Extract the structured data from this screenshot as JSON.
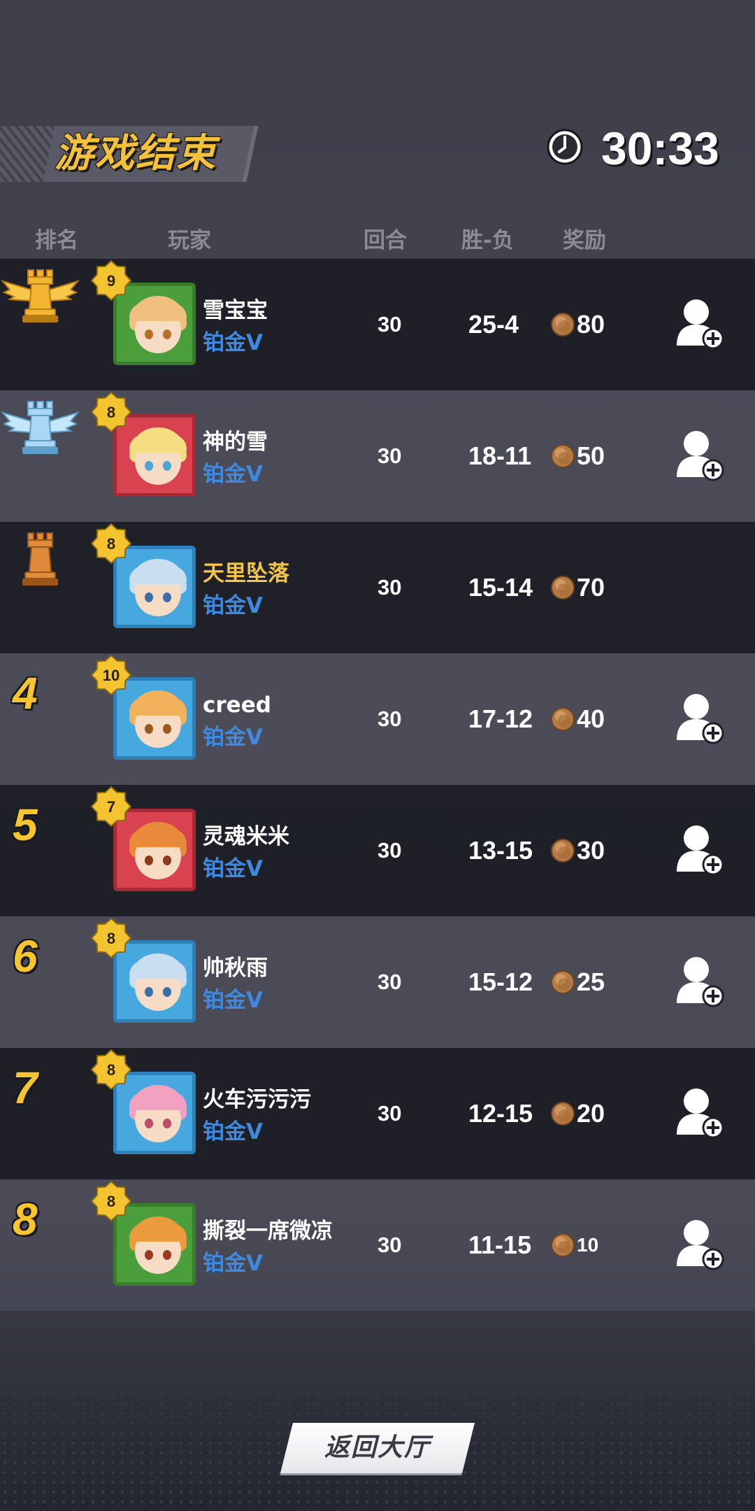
{
  "title": "游戏结束",
  "timer": "30:33",
  "headers": {
    "rank": "排名",
    "player": "玩家",
    "rounds": "回合",
    "record": "胜-负",
    "reward": "奖励"
  },
  "rows": [
    {
      "rank": "1",
      "rank_icon": "gold-rook-trophy-icon",
      "level": "9",
      "name": "雪宝宝",
      "tier": "铂金V",
      "rounds": "30",
      "record": "25-4",
      "reward": "80",
      "add_friend": true,
      "highlight": false
    },
    {
      "rank": "2",
      "rank_icon": "silver-rook-trophy-icon",
      "level": "8",
      "name": "神的雪",
      "tier": "铂金V",
      "rounds": "30",
      "record": "18-11",
      "reward": "50",
      "add_friend": true,
      "highlight": false
    },
    {
      "rank": "3",
      "rank_icon": "bronze-rook-trophy-icon",
      "level": "8",
      "name": "天里坠落",
      "tier": "铂金V",
      "rounds": "30",
      "record": "15-14",
      "reward": "70",
      "add_friend": false,
      "highlight": true
    },
    {
      "rank": "4",
      "level": "10",
      "name": "creed",
      "tier": "铂金V",
      "rounds": "30",
      "record": "17-12",
      "reward": "40",
      "add_friend": true,
      "highlight": false
    },
    {
      "rank": "5",
      "level": "7",
      "name": "灵魂米米",
      "tier": "铂金V",
      "rounds": "30",
      "record": "13-15",
      "reward": "30",
      "add_friend": true,
      "highlight": false
    },
    {
      "rank": "6",
      "level": "8",
      "name": "帅秋雨",
      "tier": "铂金V",
      "rounds": "30",
      "record": "15-12",
      "reward": "25",
      "add_friend": true,
      "highlight": false
    },
    {
      "rank": "7",
      "level": "8",
      "name": "火车污污污",
      "tier": "铂金V",
      "rounds": "30",
      "record": "12-15",
      "reward": "20",
      "add_friend": true,
      "highlight": false
    },
    {
      "rank": "8",
      "level": "8",
      "name": "撕裂一席微凉",
      "tier": "铂金V",
      "rounds": "30",
      "record": "11-15",
      "reward": "10",
      "add_friend": true,
      "highlight": false
    }
  ],
  "back_button": "返回大厅",
  "colors": {
    "title_gold": "#f3c23a",
    "tier_blue": "#3d8ae0",
    "rank_gold": "#f7c62e",
    "row_dark": "#16171e",
    "row_light": "#50505e"
  }
}
